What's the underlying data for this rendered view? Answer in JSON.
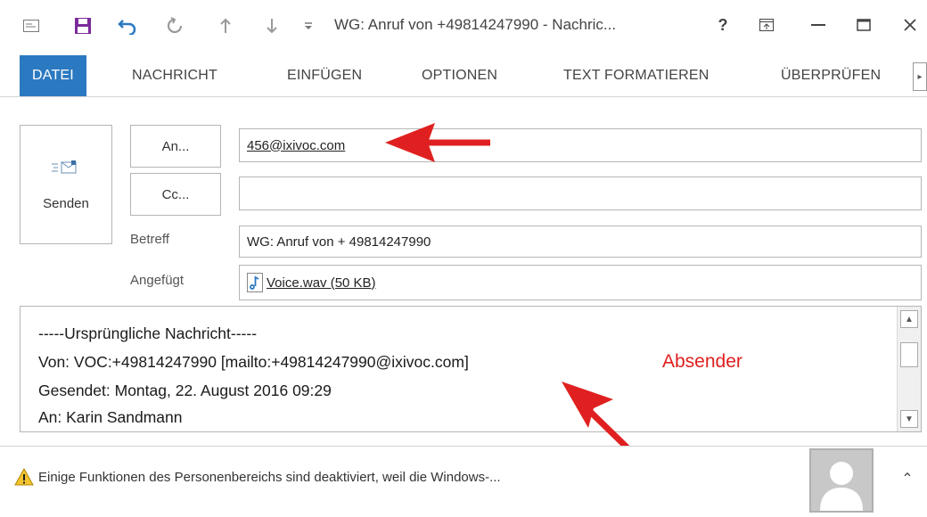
{
  "window": {
    "title": "WG: Anruf von +49814247990 - Nachric...",
    "help": "?",
    "minimize": "—",
    "maximize": "☐",
    "close": "✕"
  },
  "ribbon": {
    "tabs": [
      "DATEI",
      "NACHRICHT",
      "EINFÜGEN",
      "OPTIONEN",
      "TEXT FORMATIEREN",
      "ÜBERPRÜFEN"
    ],
    "scroll": "▸"
  },
  "compose": {
    "send_label": "Senden",
    "to_button": "An...",
    "cc_button": "Cc...",
    "to_value": "456@ixivoc.com",
    "cc_value": "",
    "subject_label": "Betreff",
    "subject_value": "WG: Anruf von + 49814247990",
    "attached_label": "Angefügt",
    "attachment": "Voice.wav (50 KB)"
  },
  "body": {
    "lines": [
      "-----Ursprüngliche Nachricht-----",
      "Von: VOC:+49814247990 [mailto:+49814247990@ixivoc.com]",
      "Gesendet: Montag, 22. August 2016 09:29",
      "An: Karin Sandmann"
    ]
  },
  "annotation": {
    "label": "Absender",
    "color": "#e02020"
  },
  "infobar": {
    "message": "Einige Funktionen des Personenbereichs sind deaktiviert, weil die Windows-...",
    "expand": "⌃"
  },
  "colors": {
    "accent": "#2b79c1",
    "save": "#7b2b9a",
    "undo": "#2b79c1"
  }
}
